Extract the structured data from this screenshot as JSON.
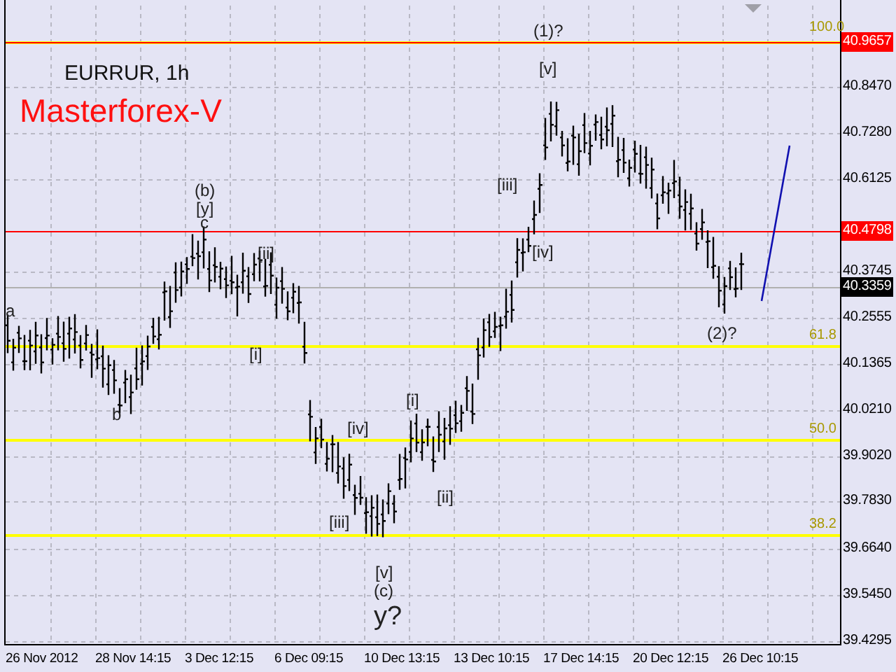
{
  "chart": {
    "symbol": "EURRUR, 1h",
    "brand": "Masterforex-V",
    "price_labels": [
      {
        "text": "40.9657",
        "kind": "marker",
        "color": "#ff0000"
      },
      {
        "text": "40.8470",
        "kind": "tick"
      },
      {
        "text": "40.7280",
        "kind": "tick"
      },
      {
        "text": "40.6125",
        "kind": "tick"
      },
      {
        "text": "40.4798",
        "kind": "marker",
        "color": "#ff0000"
      },
      {
        "text": "40.3745",
        "kind": "tick"
      },
      {
        "text": "40.3359",
        "kind": "marker",
        "color": "#000000"
      },
      {
        "text": "40.2555",
        "kind": "tick"
      },
      {
        "text": "40.1365",
        "kind": "tick"
      },
      {
        "text": "40.0210",
        "kind": "tick"
      },
      {
        "text": "39.9020",
        "kind": "tick"
      },
      {
        "text": "39.7830",
        "kind": "tick"
      },
      {
        "text": "39.6640",
        "kind": "tick"
      },
      {
        "text": "39.5450",
        "kind": "tick"
      },
      {
        "text": "39.4295",
        "kind": "tick"
      }
    ],
    "time_labels": [
      "26 Nov 2012",
      "28 Nov 14:15",
      "3 Dec 12:15",
      "6 Dec 09:15",
      "10 Dec 13:15",
      "13 Dec 10:15",
      "17 Dec 14:15",
      "20 Dec 12:15",
      "26 Dec 10:15"
    ],
    "fib_levels": [
      {
        "label": "100.0"
      },
      {
        "label": "61.8"
      },
      {
        "label": "50.0"
      },
      {
        "label": "38.2"
      }
    ],
    "wave_labels": [
      {
        "text": "(1)?",
        "kind": "minor"
      },
      {
        "text": "[v]",
        "kind": "minor"
      },
      {
        "text": "[iii]",
        "kind": "minor"
      },
      {
        "text": "(b)",
        "kind": "minor"
      },
      {
        "text": "[y]",
        "kind": "minor"
      },
      {
        "text": "c",
        "kind": "minor"
      },
      {
        "text": "[iv]",
        "kind": "minor"
      },
      {
        "text": "[ii]",
        "kind": "minor"
      },
      {
        "text": "a",
        "kind": "minor"
      },
      {
        "text": "(2)?",
        "kind": "minor"
      },
      {
        "text": "[i]",
        "kind": "minor"
      },
      {
        "text": "[i]",
        "kind": "minor"
      },
      {
        "text": "b",
        "kind": "minor"
      },
      {
        "text": "[iv]",
        "kind": "minor"
      },
      {
        "text": "[ii]",
        "kind": "minor"
      },
      {
        "text": "[iii]",
        "kind": "minor"
      },
      {
        "text": "[v]",
        "kind": "minor"
      },
      {
        "text": "(c)",
        "kind": "minor"
      },
      {
        "text": "y?",
        "kind": "major"
      }
    ]
  }
}
